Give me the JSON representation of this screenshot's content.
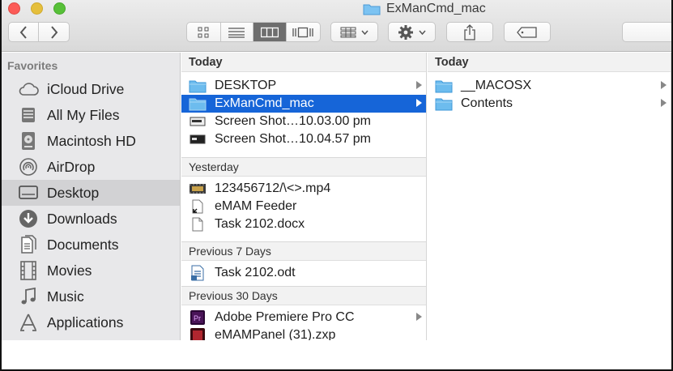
{
  "window": {
    "title": "ExManCmd_mac"
  },
  "toolbar": {
    "back_icon": "chevron-left",
    "forward_icon": "chevron-right",
    "view_modes": [
      "icon-view",
      "list-view",
      "column-view",
      "cover-flow-view"
    ],
    "active_view": "column-view",
    "arrange_icon": "grid-dropdown",
    "action_icon": "gear-dropdown",
    "share_icon": "share",
    "tags_icon": "tag"
  },
  "sidebar": {
    "header": "Favorites",
    "items": [
      {
        "label": "iCloud Drive",
        "icon": "cloud-icon"
      },
      {
        "label": "All My Files",
        "icon": "stack-icon"
      },
      {
        "label": "Macintosh HD",
        "icon": "harddrive-icon"
      },
      {
        "label": "AirDrop",
        "icon": "airdrop-icon"
      },
      {
        "label": "Desktop",
        "icon": "desktop-icon",
        "selected": true
      },
      {
        "label": "Downloads",
        "icon": "download-icon"
      },
      {
        "label": "Documents",
        "icon": "documents-icon"
      },
      {
        "label": "Movies",
        "icon": "film-icon"
      },
      {
        "label": "Music",
        "icon": "music-icon"
      },
      {
        "label": "Applications",
        "icon": "applications-icon"
      }
    ]
  },
  "column1": {
    "groups": [
      {
        "header": "Today",
        "items": [
          {
            "label": "DESKTOP",
            "icon": "folder-icon",
            "arrow": true
          },
          {
            "label": "ExManCmd_mac",
            "icon": "folder-icon",
            "arrow": true,
            "selected": true
          },
          {
            "label": "Screen Shot…10.03.00 pm",
            "icon": "screenshot-icon"
          },
          {
            "label": "Screen Shot…10.04.57 pm",
            "icon": "screenshot-icon"
          }
        ]
      },
      {
        "header": "Yesterday",
        "items": [
          {
            "label": "123456712/\\<>.mp4",
            "icon": "video-icon"
          },
          {
            "label": "eMAM Feeder",
            "icon": "alias-icon"
          },
          {
            "label": "Task 2102.docx",
            "icon": "document-icon"
          }
        ]
      },
      {
        "header": "Previous 7 Days",
        "items": [
          {
            "label": "Task 2102.odt",
            "icon": "odt-icon"
          }
        ]
      },
      {
        "header": "Previous 30 Days",
        "items": [
          {
            "label": "Adobe Premiere Pro CC",
            "icon": "premiere-icon",
            "arrow": true
          },
          {
            "label": "eMAMPanel (31).zxp",
            "icon": "zxp-icon"
          }
        ]
      }
    ]
  },
  "column2": {
    "groups": [
      {
        "header": "Today",
        "items": [
          {
            "label": "__MACOSX",
            "icon": "folder-icon",
            "arrow": true
          },
          {
            "label": "Contents",
            "icon": "folder-icon",
            "arrow": true
          }
        ]
      }
    ]
  },
  "colors": {
    "selection": "#1665d8",
    "folder": "#5fb3ec",
    "sidebar_bg": "#e8e8ea"
  }
}
